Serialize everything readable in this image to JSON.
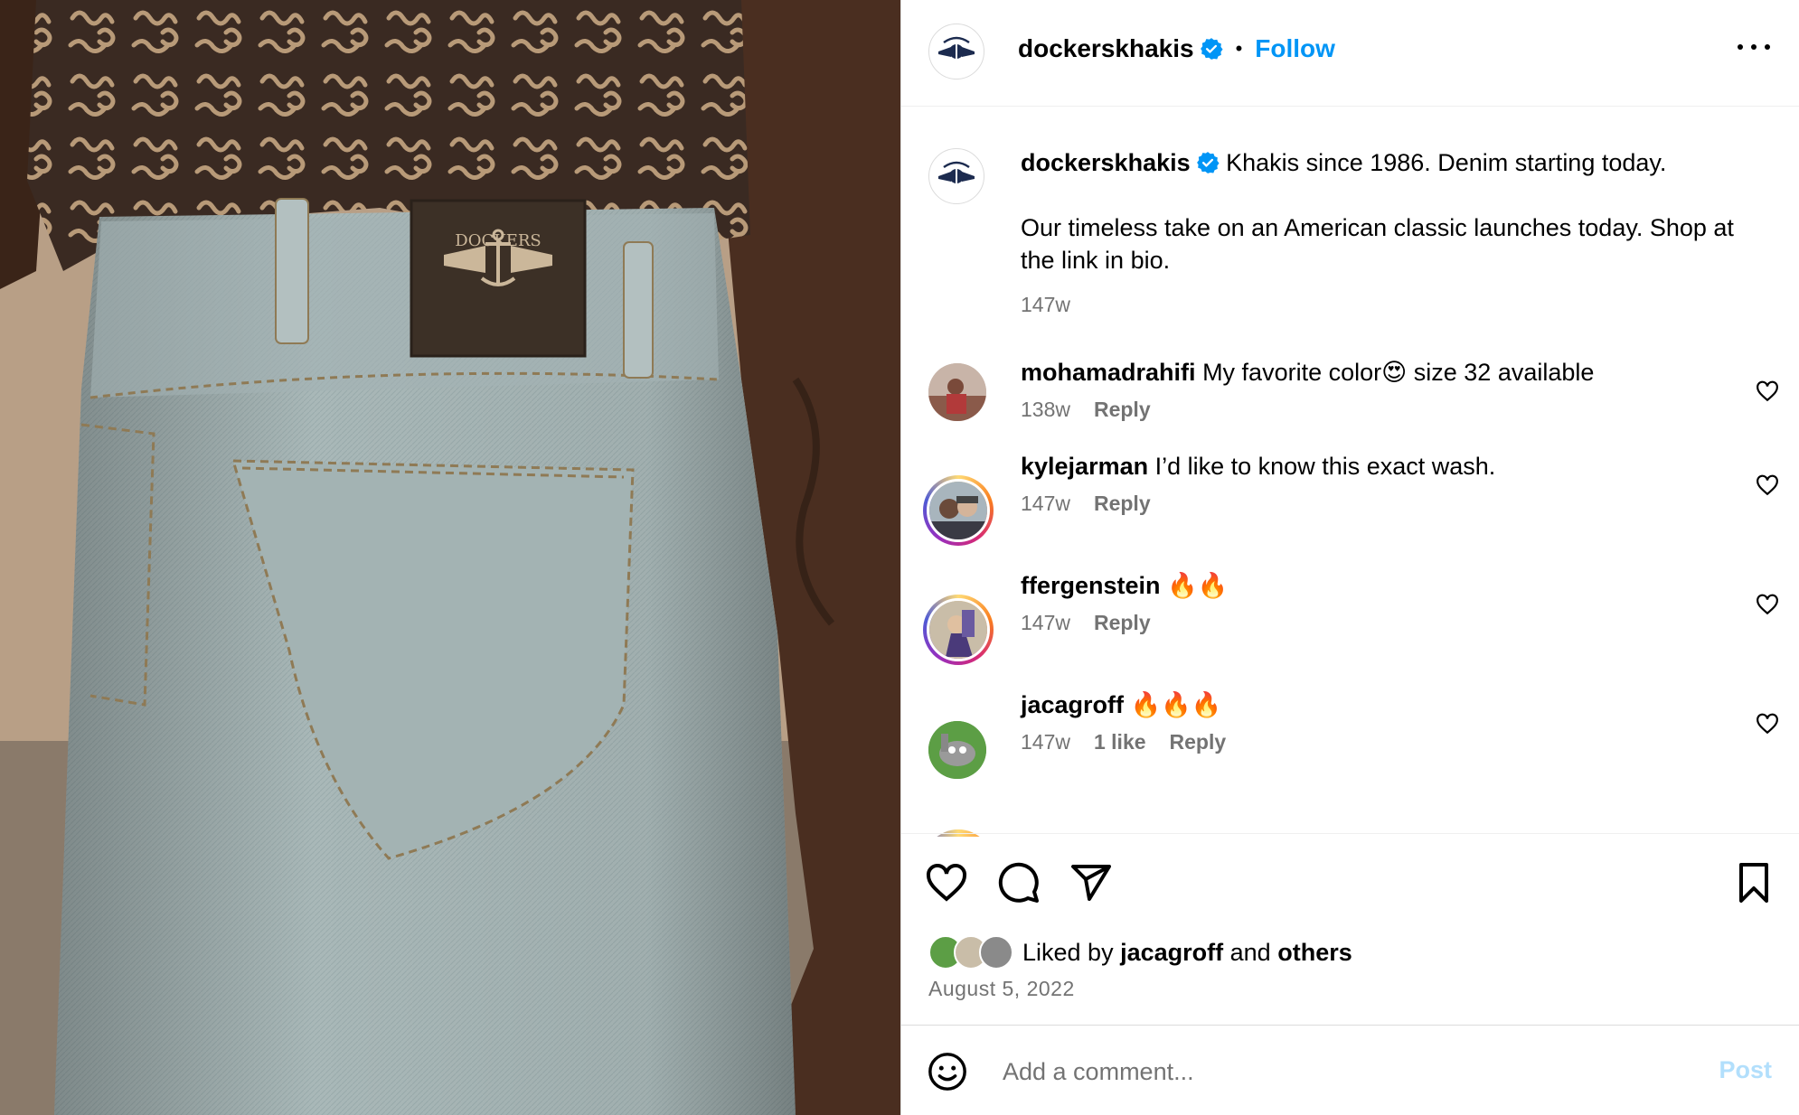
{
  "header": {
    "username": "dockerskhakis",
    "separator": "•",
    "follow_label": "Follow",
    "more_icon": "more-horizontal-icon",
    "verified_icon": "verified-badge-icon"
  },
  "photo": {
    "label_brand": "DOCKERS"
  },
  "caption": {
    "username": "dockerskhakis",
    "line1": "Khakis since 1986. Denim starting today.",
    "line2": "Our timeless take on an American classic launches today. Shop at the link in bio.",
    "time": "147w"
  },
  "comments": [
    {
      "username": "mohamadrahifi",
      "text": "My favorite color😍 size 32 available",
      "time": "138w",
      "likes": "",
      "reply": "Reply"
    },
    {
      "username": "kylejarman",
      "text": "I’d like to know this exact wash.",
      "time": "147w",
      "likes": "",
      "reply": "Reply"
    },
    {
      "username": "ffergenstein",
      "text": "🔥🔥",
      "time": "147w",
      "likes": "",
      "reply": "Reply"
    },
    {
      "username": "jacagroff",
      "text": "🔥🔥🔥",
      "time": "147w",
      "likes": "1 like",
      "reply": "Reply"
    }
  ],
  "actions": {
    "liked_prefix": "Liked by",
    "liked_user": "jacagroff",
    "liked_and": "and",
    "liked_others": "others",
    "date": "August 5, 2022"
  },
  "add_comment": {
    "placeholder": "Add a comment...",
    "post_label": "Post"
  },
  "colors": {
    "accent": "#0095f6",
    "muted": "#737373",
    "post_disabled": "#b2dffc"
  }
}
